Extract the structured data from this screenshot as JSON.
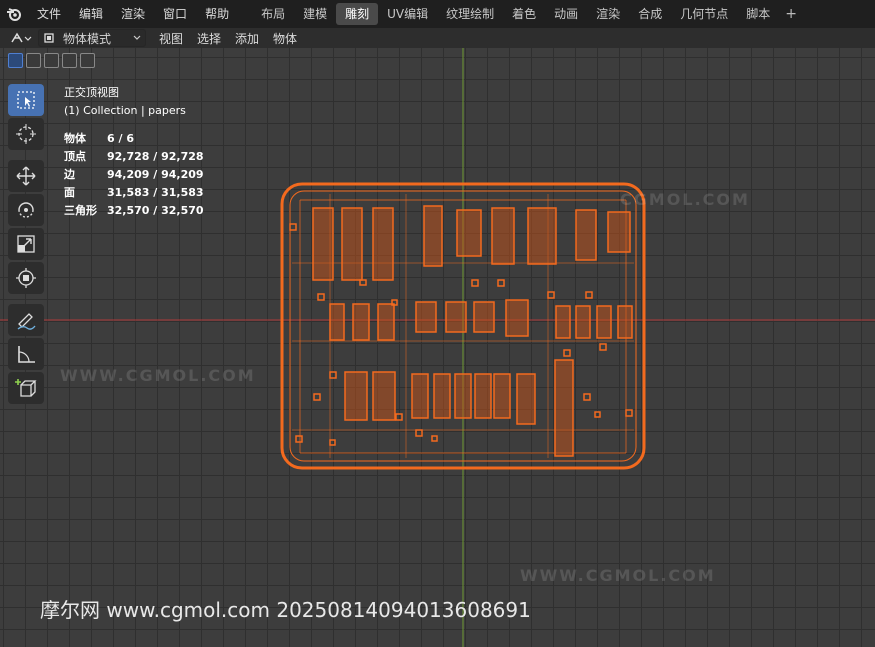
{
  "menu": [
    "文件",
    "编辑",
    "渲染",
    "窗口",
    "帮助"
  ],
  "workspace_tabs": [
    {
      "label": "布局",
      "active": false
    },
    {
      "label": "建模",
      "active": false
    },
    {
      "label": "雕刻",
      "active": true
    },
    {
      "label": "UV编辑",
      "active": false
    },
    {
      "label": "纹理绘制",
      "active": false
    },
    {
      "label": "着色",
      "active": false
    },
    {
      "label": "动画",
      "active": false
    },
    {
      "label": "渲染",
      "active": false
    },
    {
      "label": "合成",
      "active": false
    },
    {
      "label": "几何节点",
      "active": false
    },
    {
      "label": "脚本",
      "active": false
    }
  ],
  "header": {
    "mode": "物体模式",
    "menus": [
      "视图",
      "选择",
      "添加",
      "物体"
    ]
  },
  "viewport": {
    "view_name": "正交顶视图",
    "collection": "(1) Collection | papers",
    "stats": [
      {
        "label": "物体",
        "value": "6 / 6"
      },
      {
        "label": "顶点",
        "value": "92,728 / 92,728"
      },
      {
        "label": "边",
        "value": "94,209 / 94,209"
      },
      {
        "label": "面",
        "value": "31,583 / 31,583"
      },
      {
        "label": "三角形",
        "value": "32,570 / 32,570"
      }
    ]
  },
  "tools": [
    "select-box-icon",
    "cursor-icon",
    "move-icon",
    "rotate-icon",
    "scale-icon",
    "transform-icon",
    "annotate-icon",
    "measure-icon",
    "add-cube-icon"
  ],
  "colors": {
    "accent": "#4772b3",
    "selection": "#f36a1e",
    "x_axis": "#b03a3a",
    "y_axis": "#6f9a32"
  },
  "watermark": "摩尔网 www.cgmol.com 20250814094013608691"
}
